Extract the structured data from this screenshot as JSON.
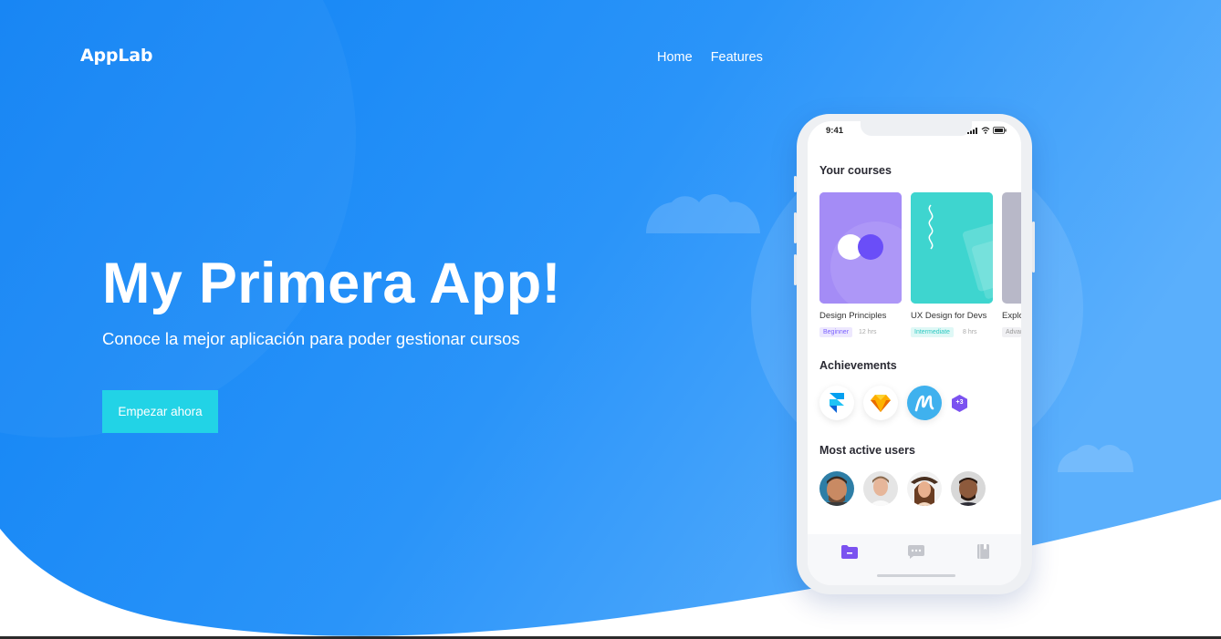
{
  "brand": {
    "name": "AppLab"
  },
  "nav": {
    "items": [
      "Home",
      "Features"
    ]
  },
  "hero": {
    "title": "My Primera App!",
    "subtitle": "Conoce la mejor aplicación para poder gestionar cursos",
    "cta_label": "Empezar ahora"
  },
  "colors": {
    "primary": "#1a8cf5",
    "accent": "#22d3e6",
    "purple": "#7b61ff"
  },
  "phone": {
    "time": "9:41",
    "courses_title": "Your courses",
    "courses": [
      {
        "name": "Design Principles",
        "level": "Beginner",
        "hours": "12 hrs"
      },
      {
        "name": "UX Design for Devs",
        "level": "Intermediate",
        "hours": "8 hrs"
      },
      {
        "name": "Explor",
        "level": "Advar",
        "hours": ""
      }
    ],
    "achievements_title": "Achievements",
    "achievements": [
      {
        "icon": "framer-icon"
      },
      {
        "icon": "sketch-icon"
      },
      {
        "icon": "m-logo-icon"
      }
    ],
    "achievements_more": "+3",
    "users_title": "Most active users",
    "tabs": [
      "folder-icon",
      "chat-icon",
      "book-icon"
    ]
  }
}
